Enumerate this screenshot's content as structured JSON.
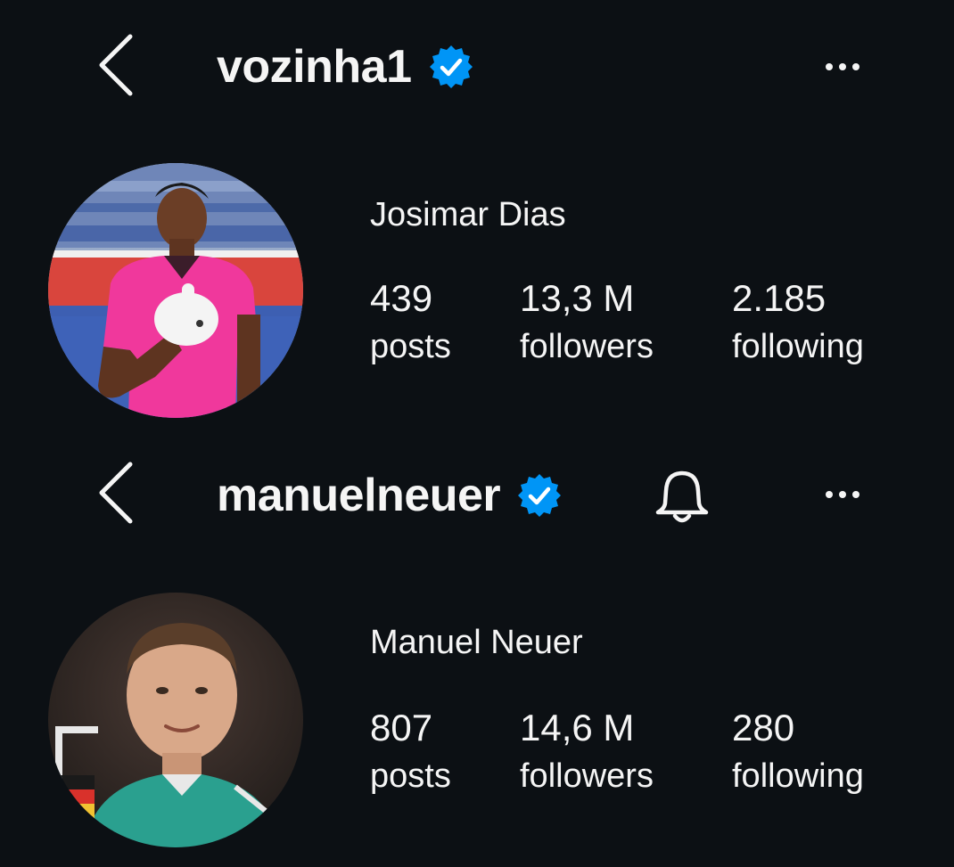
{
  "profiles": [
    {
      "username": "vozinha1",
      "verified": true,
      "display_name": "Josimar Dias",
      "avatar_desc": "goalkeeper-pink-kit-photo",
      "stats": {
        "posts_value": "439",
        "posts_label": "posts",
        "followers_value": "13,3 M",
        "followers_label": "followers",
        "following_value": "2.185",
        "following_label": "following"
      },
      "header_icons": [
        "chevron-left-icon",
        "verified-badge-icon",
        "more-dots-icon"
      ]
    },
    {
      "username": "manuelneuer",
      "verified": true,
      "display_name": "Manuel Neuer",
      "avatar_desc": "goalkeeper-green-kit-photo",
      "stats": {
        "posts_value": "807",
        "posts_label": "posts",
        "followers_value": "14,6 M",
        "followers_label": "followers",
        "following_value": "280",
        "following_label": "following"
      },
      "header_icons": [
        "chevron-left-icon",
        "verified-badge-icon",
        "bell-icon",
        "more-dots-icon"
      ]
    }
  ],
  "colors": {
    "background": "#0c1014",
    "text": "#f5f5f5",
    "verified": "#0095f6"
  }
}
